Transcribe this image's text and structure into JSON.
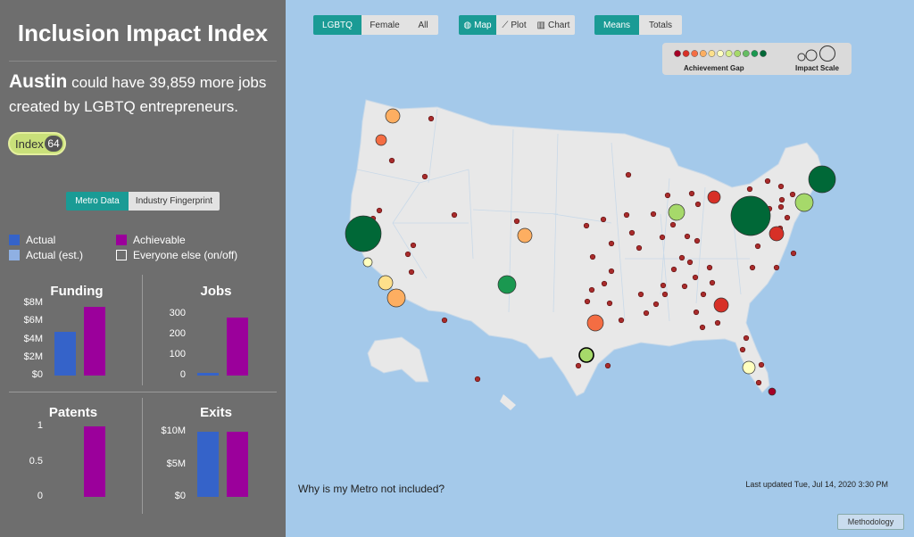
{
  "sidebar": {
    "title": "Inclusion Impact Index",
    "headline_city": "Austin",
    "headline_text": "could have 39,859 more jobs created by LGBTQ entrepreneurs.",
    "index_label": "Index",
    "index_value": "64",
    "tabs": [
      {
        "label": "Metro Data",
        "active": true
      },
      {
        "label": "Industry Fingerprint",
        "active": false
      }
    ],
    "legend": [
      {
        "label": "Actual",
        "color": "#3563c9"
      },
      {
        "label": "Achievable",
        "color": "#9b009b"
      },
      {
        "label": "Actual (est.)",
        "color": "#8fb0e3"
      },
      {
        "label": "Everyone else (on/off)",
        "color": "#6e6e6e"
      }
    ]
  },
  "chart_data": [
    {
      "type": "bar",
      "title": "Funding",
      "categories": [
        "Actual",
        "Achievable"
      ],
      "values": [
        4.8,
        7.6
      ],
      "yticks": [
        "$8M",
        "$6M",
        "$4M",
        "$2M",
        "$0"
      ],
      "ylim": [
        0,
        8
      ]
    },
    {
      "type": "bar",
      "title": "Jobs",
      "categories": [
        "Actual",
        "Achievable"
      ],
      "values": [
        15,
        322
      ],
      "yticks": [
        "300",
        "200",
        "100",
        "0"
      ],
      "ylim": [
        0,
        340
      ]
    },
    {
      "type": "bar",
      "title": "Patents",
      "categories": [
        "Actual",
        "Achievable"
      ],
      "values": [
        0,
        1
      ],
      "yticks": [
        "1",
        "0.5",
        "0"
      ],
      "ylim": [
        0,
        1
      ]
    },
    {
      "type": "bar",
      "title": "Exits",
      "categories": [
        "Actual",
        "Achievable"
      ],
      "values": [
        10,
        10
      ],
      "yticks": [
        "$10M",
        "$5M",
        "$0"
      ],
      "ylim": [
        0,
        10
      ]
    }
  ],
  "controls": {
    "group": [
      {
        "label": "LGBTQ",
        "active": true
      },
      {
        "label": "Female",
        "active": false
      },
      {
        "label": "All",
        "active": false
      }
    ],
    "view": [
      {
        "label": "Map",
        "icon": "globe-icon",
        "active": true
      },
      {
        "label": "Plot",
        "icon": "line-chart-icon",
        "active": false
      },
      {
        "label": "Chart",
        "icon": "bar-chart-icon",
        "active": false
      }
    ],
    "measure": [
      {
        "label": "Means",
        "active": true
      },
      {
        "label": "Totals",
        "active": false
      }
    ]
  },
  "map_legend": {
    "gap_label": "Achievement Gap",
    "scale_label": "Impact Scale",
    "gap_colors": [
      "#a50026",
      "#d73027",
      "#f46d43",
      "#fdae61",
      "#fee08b",
      "#ffffbf",
      "#d9ef8b",
      "#a6d96a",
      "#66bd63",
      "#1a9850",
      "#006837"
    ]
  },
  "map": {
    "colors": {
      "land": "#e8e8e8",
      "water": "#a4c9ea",
      "border": "#c9d9e8"
    }
  },
  "footer": {
    "why_link": "Why is my Metro not included?",
    "updated": "Last updated Tue, Jul 14, 2020 3:30 PM",
    "methodology": "Methodology"
  }
}
